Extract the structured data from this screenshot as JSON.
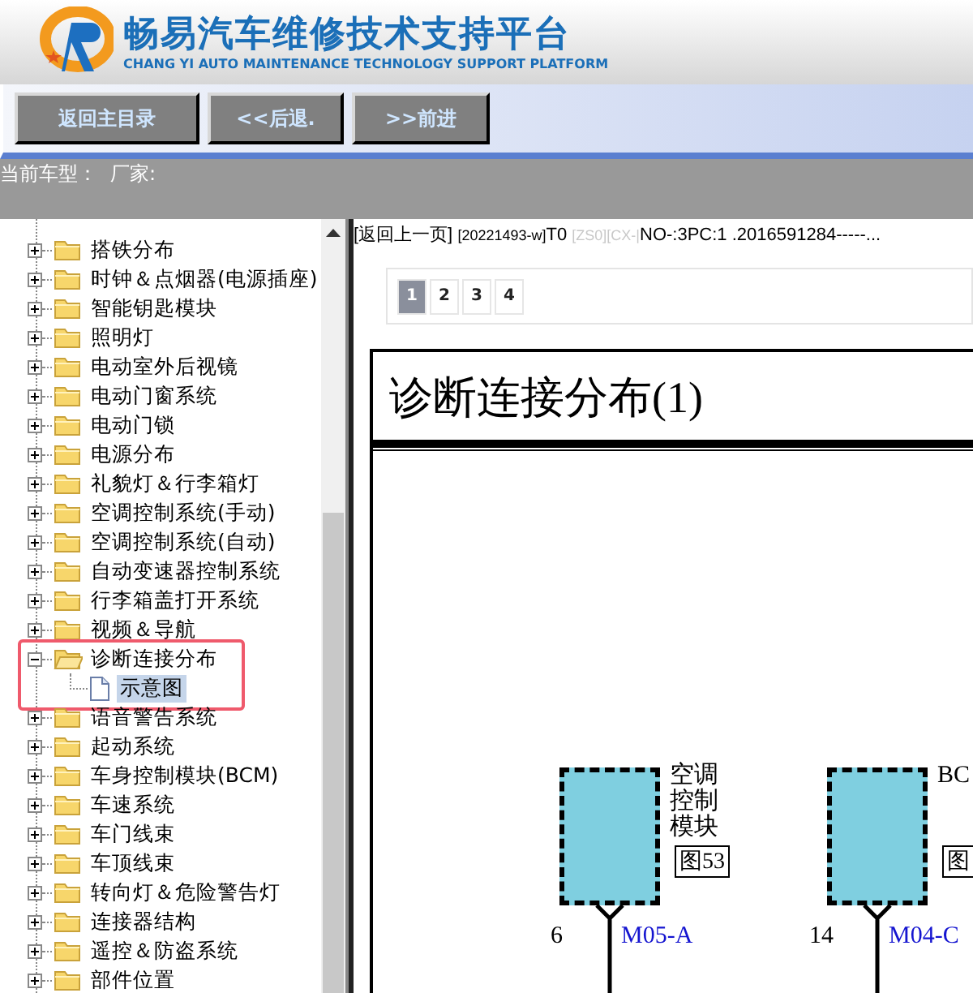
{
  "header": {
    "title": "畅易汽车维修技术支持平台",
    "subtitle": "CHANG YI AUTO MAINTENANCE TECHNOLOGY SUPPORT PLATFORM"
  },
  "toolbar": {
    "buttons": [
      "返回主目录",
      "<<后退.",
      ">>前进"
    ]
  },
  "status": {
    "model_label": "当前车型：",
    "maker_label": "厂家:"
  },
  "tree": {
    "items": [
      {
        "label": "搭铁分布",
        "expanded": false,
        "selected": false
      },
      {
        "label": "时钟＆点烟器(电源插座)",
        "expanded": false,
        "selected": false
      },
      {
        "label": "智能钥匙模块",
        "expanded": false,
        "selected": false
      },
      {
        "label": "照明灯",
        "expanded": false,
        "selected": false
      },
      {
        "label": "电动室外后视镜",
        "expanded": false,
        "selected": false
      },
      {
        "label": "电动门窗系统",
        "expanded": false,
        "selected": false
      },
      {
        "label": "电动门锁",
        "expanded": false,
        "selected": false
      },
      {
        "label": "电源分布",
        "expanded": false,
        "selected": false
      },
      {
        "label": "礼貌灯＆行李箱灯",
        "expanded": false,
        "selected": false
      },
      {
        "label": "空调控制系统(手动)",
        "expanded": false,
        "selected": false
      },
      {
        "label": "空调控制系统(自动)",
        "expanded": false,
        "selected": false
      },
      {
        "label": "自动变速器控制系统",
        "expanded": false,
        "selected": false
      },
      {
        "label": "行李箱盖打开系统",
        "expanded": false,
        "selected": false
      },
      {
        "label": "视频＆导航",
        "expanded": false,
        "selected": false
      },
      {
        "label": "诊断连接分布",
        "expanded": true,
        "selected": false,
        "highlighted": true,
        "children": [
          {
            "label": "示意图",
            "selected": true
          }
        ]
      },
      {
        "label": "语音警告系统",
        "expanded": false,
        "selected": false
      },
      {
        "label": "起动系统",
        "expanded": false,
        "selected": false
      },
      {
        "label": "车身控制模块(BCM)",
        "expanded": false,
        "selected": false
      },
      {
        "label": "车速系统",
        "expanded": false,
        "selected": false
      },
      {
        "label": "车门线束",
        "expanded": false,
        "selected": false
      },
      {
        "label": "车顶线束",
        "expanded": false,
        "selected": false
      },
      {
        "label": "转向灯＆危险警告灯",
        "expanded": false,
        "selected": false
      },
      {
        "label": "连接器结构",
        "expanded": false,
        "selected": false
      },
      {
        "label": "遥控＆防盗系统",
        "expanded": false,
        "selected": false
      },
      {
        "label": "部件位置",
        "expanded": false,
        "selected": false
      }
    ]
  },
  "content": {
    "breadcrumb": {
      "back_link": "[返回上一页]",
      "code": "[20221493-w]",
      "t": "T0",
      "muted": "[ZS0][CX-|",
      "rest": "NO-:3PC:1 .2016591284-----..."
    },
    "pagination": [
      {
        "label": "1",
        "selected": true
      },
      {
        "label": "2",
        "selected": false
      },
      {
        "label": "3",
        "selected": false
      },
      {
        "label": "4",
        "selected": false
      }
    ],
    "diagram": {
      "title": "诊断连接分布(1)",
      "components": [
        {
          "label": "空调控制模块",
          "ref": "图53",
          "pin": "6",
          "connector": "M05-A"
        },
        {
          "label": "BC",
          "ref": "图",
          "pin": "14",
          "connector": "M04-C"
        }
      ]
    }
  }
}
